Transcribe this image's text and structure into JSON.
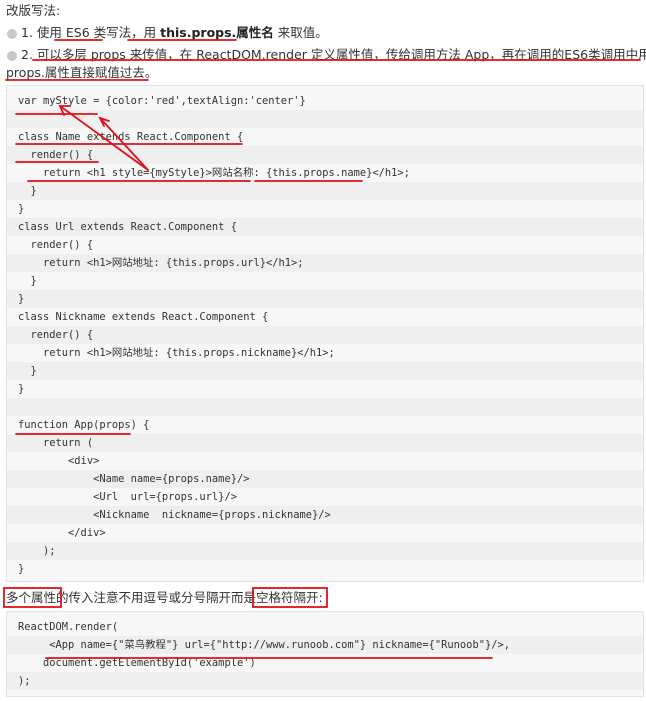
{
  "intro": "改版写法:",
  "items": [
    {
      "prefix": "1. 使用 ES6 类写法，用 ",
      "bold": "this.props.属性名",
      "suffix": " 来取值。"
    },
    {
      "line1": "2. 可以多层 props 来传值，在 ReactDOM.render 定义属性值，传给调用方法 App，再在调用的ES6类调用中用",
      "line2": "props.属性直接赋值过去。"
    }
  ],
  "code1": [
    "var myStyle = {color:'red',textAlign:'center'}",
    "",
    "class Name extends React.Component {",
    "  render() {",
    "    return <h1 style={myStyle}>网站名称: {this.props.name}</h1>;",
    "  }",
    "}",
    "class Url extends React.Component {",
    "  render() {",
    "    return <h1>网站地址: {this.props.url}</h1>;",
    "  }",
    "}",
    "class Nickname extends React.Component {",
    "  render() {",
    "    return <h1>网站地址: {this.props.nickname}</h1>;",
    "  }",
    "}",
    "",
    "function App(props) {",
    "    return (",
    "        <div>",
    "            <Name name={props.name}/>",
    "            <Url  url={props.url}/>",
    "            <Nickname  nickname={props.nickname}/>",
    "        </div>",
    "    );",
    "}"
  ],
  "note": "多个属性的传入注意不用逗号或分号隔开而是空格符隔开:",
  "code2": [
    "ReactDOM.render(",
    "     <App name={\"菜鸟教程\"} url={\"http://www.runoob.com\"} nickname={\"Runoob\"}/>,",
    "    document.getElementById('example')",
    ");"
  ],
  "colors": {
    "annotation": "#e0101a",
    "bold": "#222222"
  }
}
